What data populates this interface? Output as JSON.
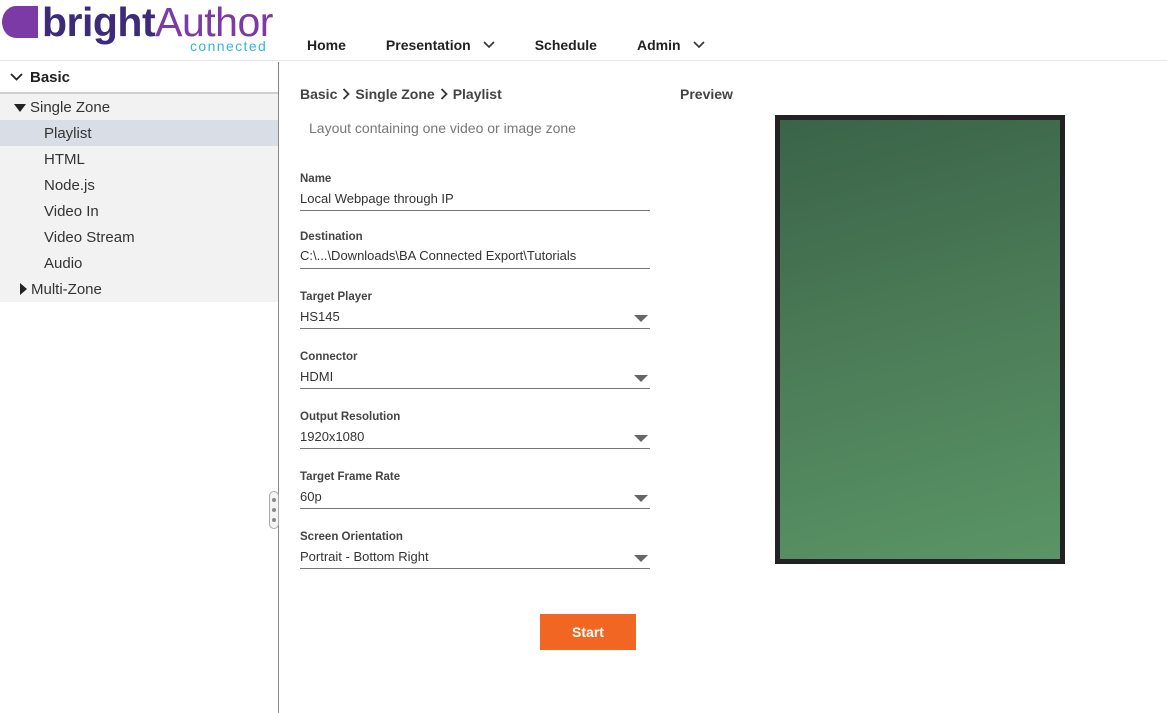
{
  "header": {
    "logo": {
      "word_bright": "bright",
      "word_author": "Author",
      "sub": "connected"
    },
    "nav": [
      {
        "label": "Home",
        "has_dropdown": false
      },
      {
        "label": "Presentation",
        "has_dropdown": true
      },
      {
        "label": "Schedule",
        "has_dropdown": false
      },
      {
        "label": "Admin",
        "has_dropdown": true
      }
    ]
  },
  "sidebar": {
    "root_label": "Basic",
    "groups": [
      {
        "label": "Single Zone",
        "expanded": true,
        "items": [
          "Playlist",
          "HTML",
          "Node.js",
          "Video In",
          "Video Stream",
          "Audio"
        ],
        "selected": "Playlist"
      },
      {
        "label": "Multi-Zone",
        "expanded": false
      }
    ]
  },
  "main": {
    "breadcrumb": [
      "Basic",
      "Single Zone",
      "Playlist"
    ],
    "description": "Layout containing one video or image zone",
    "fields": [
      {
        "label": "Name",
        "value": "Local Webpage through IP",
        "type": "text"
      },
      {
        "label": "Destination",
        "value": "C:\\...\\Downloads\\BA Connected Export\\Tutorials",
        "type": "text"
      },
      {
        "label": "Target Player",
        "value": "HS145",
        "type": "select"
      },
      {
        "label": "Connector",
        "value": "HDMI",
        "type": "select"
      },
      {
        "label": "Output Resolution",
        "value": "1920x1080",
        "type": "select"
      },
      {
        "label": "Target Frame Rate",
        "value": "60p",
        "type": "select"
      },
      {
        "label": "Screen Orientation",
        "value": "Portrait - Bottom Right",
        "type": "select"
      }
    ],
    "start_label": "Start"
  },
  "preview": {
    "label": "Preview",
    "orientation": "portrait",
    "gradient_colors": [
      "#3a6448",
      "#5a9566"
    ]
  },
  "colors": {
    "accent": "#f26624",
    "logo_primary": "#3d2a78",
    "logo_secondary": "#7b3aa6",
    "logo_sub": "#35b5d8",
    "selected_row": "#d8dde6"
  }
}
